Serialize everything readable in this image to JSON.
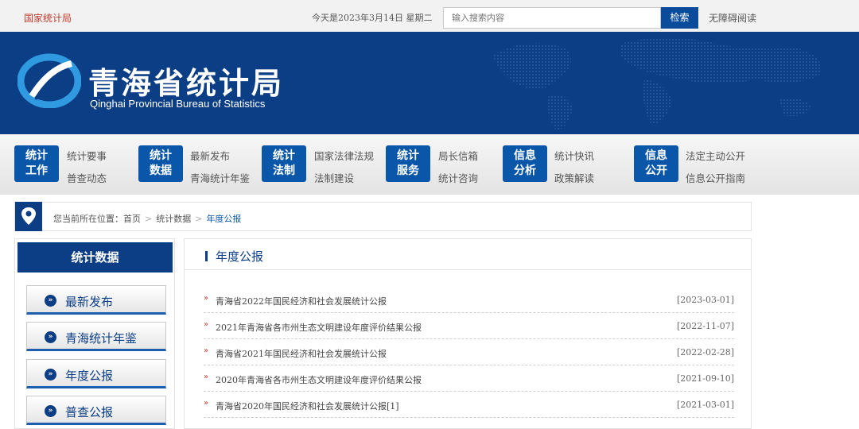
{
  "topbar": {
    "site_name": "国家统计局",
    "date_text": "今天是2023年3月14日  星期二",
    "search_placeholder": "输入搜索内容",
    "search_button": "检索",
    "accessibility": "无障碍阅读"
  },
  "banner": {
    "title_cn": "青海省统计局",
    "title_en": "Qinghai Provincial Bureau of Statistics"
  },
  "nav": [
    {
      "badge": [
        "统计",
        "工作"
      ],
      "links": [
        "统计要事",
        "普查动态"
      ]
    },
    {
      "badge": [
        "统计",
        "数据"
      ],
      "links": [
        "最新发布",
        "青海统计年鉴"
      ]
    },
    {
      "badge": [
        "统计",
        "法制"
      ],
      "links": [
        "国家法律法规",
        "法制建设"
      ]
    },
    {
      "badge": [
        "统计",
        "服务"
      ],
      "links": [
        "局长信箱",
        "统计咨询"
      ]
    },
    {
      "badge": [
        "信息",
        "分析"
      ],
      "links": [
        "统计快讯",
        "政策解读"
      ]
    },
    {
      "badge": [
        "信息",
        "公开"
      ],
      "links": [
        "法定主动公开",
        "信息公开指南"
      ]
    }
  ],
  "breadcrumb": {
    "prefix": "您当前所在位置：",
    "items": [
      "首页",
      "统计数据",
      "年度公报"
    ]
  },
  "sidebar": {
    "title": "统计数据",
    "items": [
      "最新发布",
      "青海统计年鉴",
      "年度公报",
      "普查公报"
    ]
  },
  "main": {
    "title": "年度公报",
    "rows": [
      {
        "title": "青海省2022年国民经济和社会发展统计公报",
        "date": "[2023-03-01]"
      },
      {
        "title": "2021年青海省各市州生态文明建设年度评价结果公报",
        "date": "[2022-11-07]"
      },
      {
        "title": "青海省2021年国民经济和社会发展统计公报",
        "date": "[2022-02-28]"
      },
      {
        "title": "2020年青海省各市州生态文明建设年度评价结果公报",
        "date": "[2021-09-10]"
      },
      {
        "title": "青海省2020年国民经济和社会发展统计公报[1]",
        "date": "[2021-03-01]"
      }
    ]
  },
  "colors": {
    "brand_blue": "#0c3e86",
    "accent_red": "#c0392b",
    "button_blue": "#0a57a9"
  }
}
